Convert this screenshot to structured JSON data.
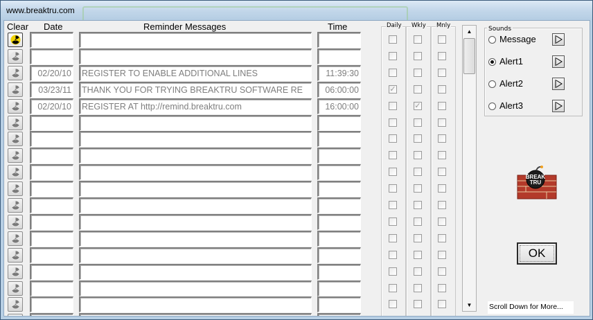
{
  "window": {
    "title": "www.breaktru.com"
  },
  "headers": {
    "clear": "Clear",
    "date": "Date",
    "messages": "Reminder Messages",
    "time": "Time"
  },
  "reminders": [
    {
      "date": "",
      "message": "",
      "time": "",
      "daily": false,
      "weekly": false,
      "monthly": false
    },
    {
      "date": "",
      "message": "",
      "time": "",
      "daily": false,
      "weekly": false,
      "monthly": false
    },
    {
      "date": "02/20/10",
      "message": "REGISTER TO ENABLE ADDITIONAL LINES",
      "time": "11:39:30",
      "daily": false,
      "weekly": false,
      "monthly": false
    },
    {
      "date": "03/23/11",
      "message": "THANK YOU FOR TRYING BREAKTRU SOFTWARE RE",
      "time": "06:00:00",
      "daily": true,
      "weekly": false,
      "monthly": false
    },
    {
      "date": "02/20/10",
      "message": "REGISTER AT http://remind.breaktru.com",
      "time": "16:00:00",
      "daily": false,
      "weekly": true,
      "monthly": false
    },
    {
      "date": "",
      "message": "",
      "time": "",
      "daily": false,
      "weekly": false,
      "monthly": false
    },
    {
      "date": "",
      "message": "",
      "time": "",
      "daily": false,
      "weekly": false,
      "monthly": false
    },
    {
      "date": "",
      "message": "",
      "time": "",
      "daily": false,
      "weekly": false,
      "monthly": false
    },
    {
      "date": "",
      "message": "",
      "time": "",
      "daily": false,
      "weekly": false,
      "monthly": false
    },
    {
      "date": "",
      "message": "",
      "time": "",
      "daily": false,
      "weekly": false,
      "monthly": false
    },
    {
      "date": "",
      "message": "",
      "time": "",
      "daily": false,
      "weekly": false,
      "monthly": false
    },
    {
      "date": "",
      "message": "",
      "time": "",
      "daily": false,
      "weekly": false,
      "monthly": false
    },
    {
      "date": "",
      "message": "",
      "time": "",
      "daily": false,
      "weekly": false,
      "monthly": false
    },
    {
      "date": "",
      "message": "",
      "time": "",
      "daily": false,
      "weekly": false,
      "monthly": false
    },
    {
      "date": "",
      "message": "",
      "time": "",
      "daily": false,
      "weekly": false,
      "monthly": false
    },
    {
      "date": "",
      "message": "",
      "time": "",
      "daily": false,
      "weekly": false,
      "monthly": false
    },
    {
      "date": "",
      "message": "",
      "time": "",
      "daily": false,
      "weekly": false,
      "monthly": false
    },
    {
      "date": "",
      "message": "",
      "time": "",
      "daily": false,
      "weekly": false,
      "monthly": false
    }
  ],
  "recurrence": {
    "daily": "Daily",
    "weekly": "Wkly",
    "monthly": "Mnly"
  },
  "sounds": {
    "label": "Sounds",
    "options": [
      {
        "label": "Message",
        "selected": false
      },
      {
        "label": "Alert1",
        "selected": true
      },
      {
        "label": "Alert2",
        "selected": false
      },
      {
        "label": "Alert3",
        "selected": false
      }
    ]
  },
  "logo": {
    "text_line1": "BREAK",
    "text_line2": "TRU"
  },
  "ok_label": "OK",
  "scroll_hint": "Scroll Down for More...",
  "icons": {
    "clear": "radiation-clear-icon",
    "play": "play-sound-icon",
    "scroll_up": "scroll-up-arrow-icon",
    "scroll_down": "scroll-down-arrow-icon"
  },
  "colors": {
    "field_text": "#7e7e7e",
    "window_frame": "#b7cfe4"
  }
}
